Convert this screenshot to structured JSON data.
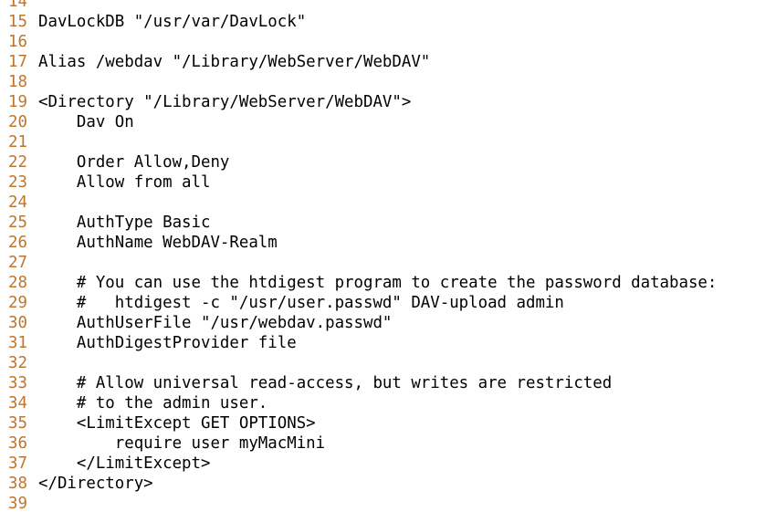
{
  "editor": {
    "colors": {
      "background": "#ffffff",
      "text": "#000000",
      "line_number": "#c0752c"
    },
    "lines": [
      {
        "number": "14",
        "text": ""
      },
      {
        "number": "15",
        "text": "DavLockDB \"/usr/var/DavLock\""
      },
      {
        "number": "16",
        "text": ""
      },
      {
        "number": "17",
        "text": "Alias /webdav \"/Library/WebServer/WebDAV\""
      },
      {
        "number": "18",
        "text": ""
      },
      {
        "number": "19",
        "text": "<Directory \"/Library/WebServer/WebDAV\">"
      },
      {
        "number": "20",
        "text": "    Dav On"
      },
      {
        "number": "21",
        "text": ""
      },
      {
        "number": "22",
        "text": "    Order Allow,Deny"
      },
      {
        "number": "23",
        "text": "    Allow from all"
      },
      {
        "number": "24",
        "text": ""
      },
      {
        "number": "25",
        "text": "    AuthType Basic"
      },
      {
        "number": "26",
        "text": "    AuthName WebDAV-Realm"
      },
      {
        "number": "27",
        "text": ""
      },
      {
        "number": "28",
        "text": "    # You can use the htdigest program to create the password database:"
      },
      {
        "number": "29",
        "text": "    #   htdigest -c \"/usr/user.passwd\" DAV-upload admin"
      },
      {
        "number": "30",
        "text": "    AuthUserFile \"/usr/webdav.passwd\""
      },
      {
        "number": "31",
        "text": "    AuthDigestProvider file"
      },
      {
        "number": "32",
        "text": ""
      },
      {
        "number": "33",
        "text": "    # Allow universal read-access, but writes are restricted"
      },
      {
        "number": "34",
        "text": "    # to the admin user."
      },
      {
        "number": "35",
        "text": "    <LimitExcept GET OPTIONS>"
      },
      {
        "number": "36",
        "text": "        require user myMacMini"
      },
      {
        "number": "37",
        "text": "    </LimitExcept>"
      },
      {
        "number": "38",
        "text": "</Directory>"
      },
      {
        "number": "39",
        "text": ""
      }
    ]
  }
}
